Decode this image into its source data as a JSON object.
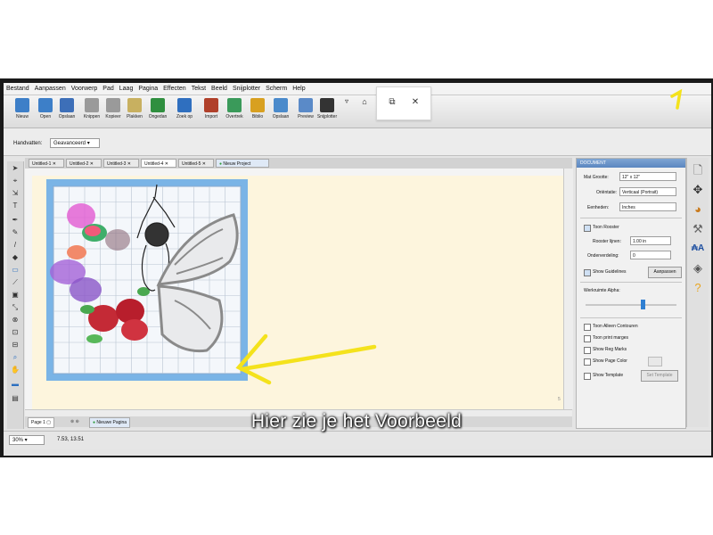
{
  "menu": [
    "Bestand",
    "Aanpassen",
    "Voorwerp",
    "Pad",
    "Laag",
    "Pagina",
    "Effecten",
    "Tekst",
    "Beeld",
    "Snijplotter",
    "Scherm",
    "Help"
  ],
  "toolbar": [
    {
      "label": "Nieuw",
      "icon": "new-file-icon",
      "color": "#3d7fc8"
    },
    {
      "label": "Open",
      "icon": "open-folder-icon",
      "color": "#3d7fc8"
    },
    {
      "label": "Opslaan",
      "icon": "save-icon",
      "color": "#3d6fb8"
    },
    {
      "label": "Knippen",
      "icon": "scissors-icon",
      "color": "#9a9a9a"
    },
    {
      "label": "Kopieer",
      "icon": "copy-icon",
      "color": "#9a9a9a"
    },
    {
      "label": "Plakken",
      "icon": "paste-icon",
      "color": "#c8b060"
    },
    {
      "label": "Ongedan",
      "icon": "undo-icon",
      "color": "#2f8f3f"
    },
    {
      "label": "Zoek op",
      "icon": "redo-icon",
      "color": "#2f6fbf"
    },
    {
      "label": "Import",
      "icon": "import-icon",
      "color": "#b0402a"
    },
    {
      "label": "Overtrek",
      "icon": "trace-icon",
      "color": "#3a9a5a"
    },
    {
      "label": "Biblio",
      "icon": "library-icon",
      "color": "#d8a020"
    },
    {
      "label": "Opslaan",
      "icon": "save-library-icon",
      "color": "#4a8acb"
    },
    {
      "label": "Preview",
      "icon": "preview-icon",
      "color": "#5a8ac8"
    },
    {
      "label": "Snijplotter",
      "icon": "cutter-icon",
      "color": "#333333"
    }
  ],
  "window_controls": {
    "restore": "⧉",
    "close": "✕"
  },
  "option_bar": {
    "label": "Handvatten:",
    "value": "Geavanceerd"
  },
  "tabs": [
    "Untitled-1",
    "Untitled-2",
    "Untitled-3",
    "Untitled-4",
    "Untitled-5"
  ],
  "new_project": "Nieuw Project",
  "page_bar": {
    "page": "Page 1",
    "new_page": "Nieuwe Pagina"
  },
  "status": {
    "zoom": "30%",
    "coords": "7.53, 13.51"
  },
  "panel": {
    "title": "DOCUMENT",
    "mat_size_label": "Mat Grootte:",
    "mat_size_value": "12\" x 12\"",
    "orientation_label": "Oriëntatie:",
    "orientation_value": "Verticaal (Portrait)",
    "units_label": "Eenheden:",
    "units_value": "Inches",
    "show_grid": "Toon Rooster",
    "grid_lines_label": "Rooster lijnen:",
    "grid_lines_value": "1.00 in",
    "subdivision_label": "Onderverdeling:",
    "subdivision_value": "0",
    "show_guidelines": "Show Guidelines",
    "adjust_button": "Aanpassen",
    "alpha_label": "Werkruimte Alpha:",
    "alpha_fraction": 0.63,
    "only_contours": "Toon Alleen Contouren",
    "print_margins": "Toon print marges",
    "reg_marks": "Show Reg Marks",
    "page_color": "Show Page Color",
    "template": "Show Template",
    "set_template": "Set Template"
  },
  "subtitle": "Hier zie je het Voorbeeld",
  "colors": {
    "canvas": "#fdf5dd",
    "mat_blue": "#7ab4e6",
    "annotation_yellow": "#f4e21c",
    "panel_header": "#5b86c0"
  }
}
